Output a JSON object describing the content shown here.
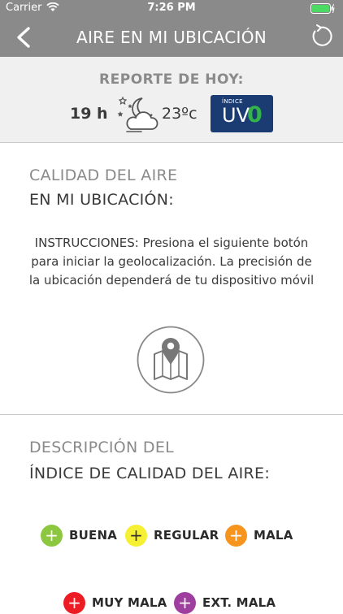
{
  "status_bar": {
    "carrier": "Carrier",
    "time": "7:26 PM"
  },
  "nav": {
    "title": "AIRE EN MI UBICACIÓN",
    "back_icon": "chevron-left-icon",
    "refresh_icon": "refresh-icon"
  },
  "report": {
    "title": "REPORTE DE HOY:",
    "hour": "19 h",
    "weather_icon": "night-partly-cloudy-icon",
    "temperature": "23ºc",
    "uv_caption": "ÍNDICE",
    "uv_label": "UV",
    "uv_value": "0",
    "uv_badge_color": "#1b3c73",
    "uv_value_color": "#33b44a"
  },
  "location": {
    "label_line1": "CALIDAD DEL AIRE",
    "label_line2": "EN MI UBICACIÓN:",
    "instructions": "INSTRUCCIONES: Presiona el siguiente botón para iniciar la geolocalización. La precisión de la ubicación dependerá de tu dispositivo móvil",
    "geo_button_icon": "map-pin-icon"
  },
  "description": {
    "label_line1": "DESCRIPCIÓN DEL",
    "label_line2": "ÍNDICE DE CALIDAD DEL AIRE:",
    "legend": [
      {
        "label": "BUENA",
        "color": "#8dc63f",
        "sign": "+"
      },
      {
        "label": "REGULAR",
        "color": "#f5f033",
        "sign": "+"
      },
      {
        "label": "MALA",
        "color": "#f7941d",
        "sign": "+"
      },
      {
        "label": "MUY MALA",
        "color": "#ed1c24",
        "sign": "+"
      },
      {
        "label": "EXT. MALA",
        "color": "#9e3fa0",
        "sign": "+"
      }
    ]
  }
}
